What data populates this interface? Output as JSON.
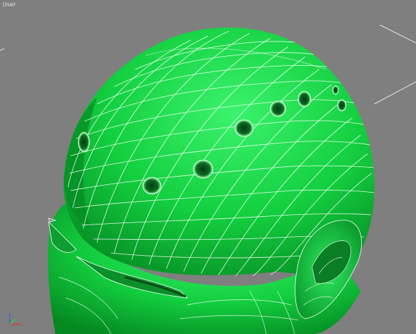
{
  "viewport": {
    "label": "User",
    "background_color": "#7f7f7f"
  },
  "model": {
    "surface_color": "#1fd34a",
    "wire_color": "#ffffff",
    "description_icon": "mesh-object-icon"
  },
  "gizmo": {
    "x_color": "#d23b3b",
    "y_color": "#3bd23b",
    "z_color": "#3b6fd2"
  }
}
